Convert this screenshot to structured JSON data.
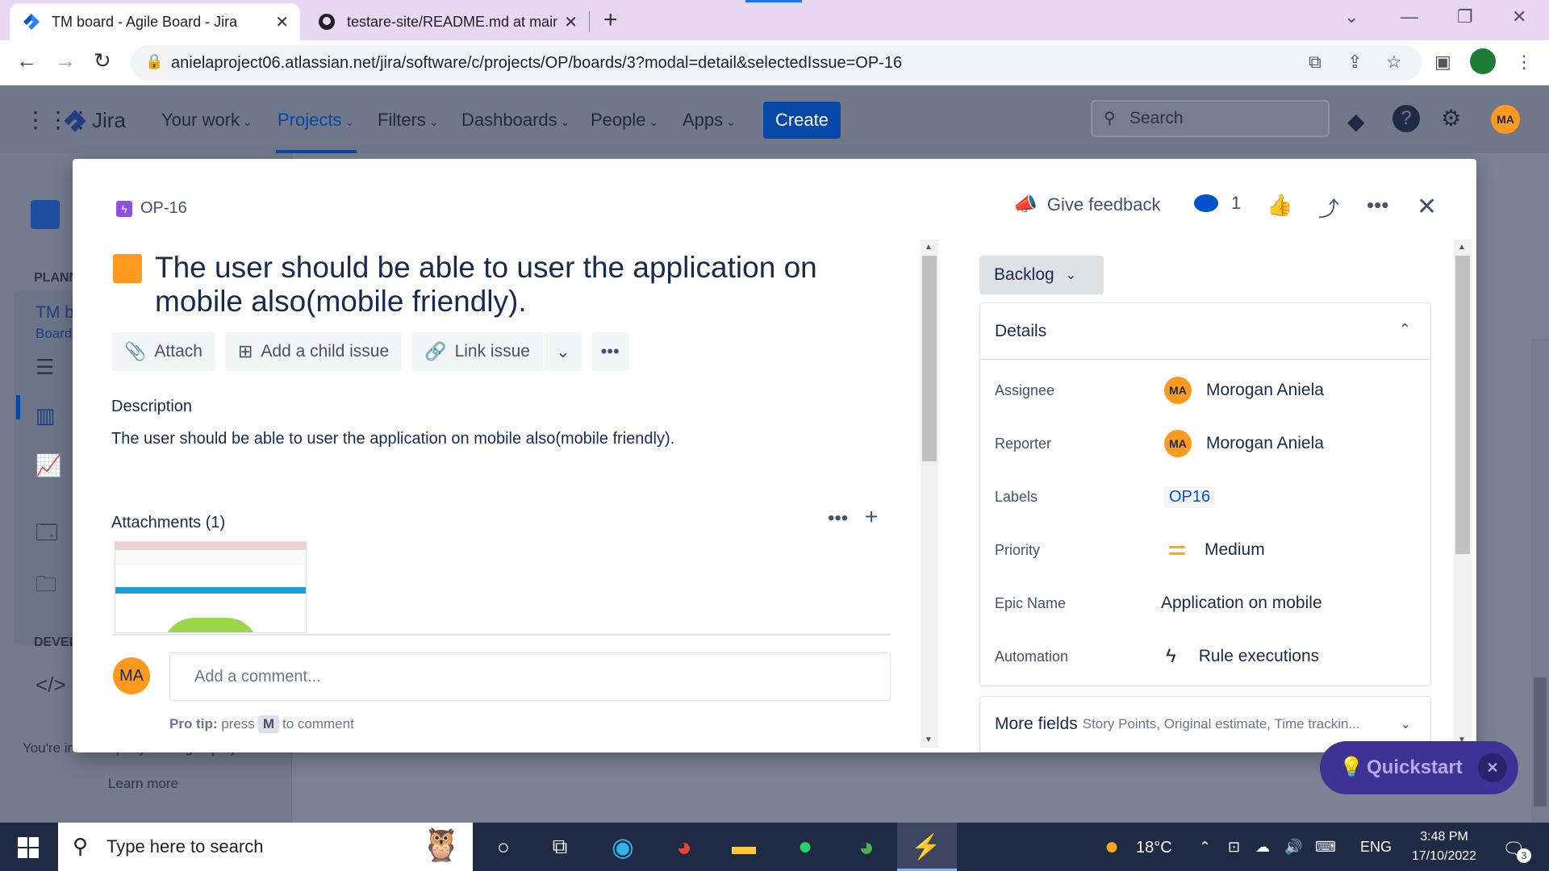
{
  "browser": {
    "tabs": [
      {
        "title": "TM board - Agile Board - Jira",
        "active": true
      },
      {
        "title": "testare-site/README.md at main",
        "active": false
      }
    ],
    "url": "anielaproject06.atlassian.net/jira/software/c/projects/OP/boards/3?modal=detail&selectedIssue=OP-16"
  },
  "jira_nav": {
    "logo": "Jira",
    "items": [
      "Your work",
      "Projects",
      "Filters",
      "Dashboards",
      "People",
      "Apps"
    ],
    "create_label": "Create",
    "search_placeholder": "Search",
    "user_initials": "MA"
  },
  "sidebar": {
    "section_planning": "PLANN",
    "board_title": "TM b",
    "board_sub": "Board",
    "section_dev": "DEVEL",
    "footer_text": "You're in a company-managed project",
    "learn_more": "Learn more"
  },
  "modal": {
    "issue_key": "OP-16",
    "give_feedback": "Give feedback",
    "watchers": "1",
    "title": "The user should be able to user the application on mobile also(mobile friendly).",
    "buttons": {
      "attach": "Attach",
      "add_child": "Add a child issue",
      "link_issue": "Link issue"
    },
    "description_label": "Description",
    "description_text": "The user should be able to user the application on mobile also(mobile friendly).",
    "attachments_label": "Attachments (1)",
    "comment_avatar": "MA",
    "comment_placeholder": "Add a comment...",
    "protip_bold": "Pro tip:",
    "protip_press": "press",
    "protip_key": "M",
    "protip_tail": "to comment",
    "status": "Backlog",
    "details_label": "Details",
    "details": {
      "assignee_label": "Assignee",
      "assignee_value": "Morogan Aniela",
      "assignee_initials": "MA",
      "reporter_label": "Reporter",
      "reporter_value": "Morogan Aniela",
      "reporter_initials": "MA",
      "labels_label": "Labels",
      "labels_value": "OP16",
      "priority_label": "Priority",
      "priority_value": "Medium",
      "epic_label": "Epic Name",
      "epic_value": "Application on mobile",
      "automation_label": "Automation",
      "automation_value": "Rule executions"
    },
    "more_fields_label": "More fields",
    "more_fields_sub": "Story Points, Original estimate, Time trackin..."
  },
  "quickstart_label": "Quickstart",
  "taskbar": {
    "search_placeholder": "Type here to search",
    "temperature": "18°C",
    "language": "ENG",
    "time": "3:48 PM",
    "date": "17/10/2022",
    "notif_count": "3"
  },
  "colors": {
    "jira_blue": "#0747a6",
    "story_orange": "#ff991f",
    "quickstart_purple": "#403294"
  }
}
